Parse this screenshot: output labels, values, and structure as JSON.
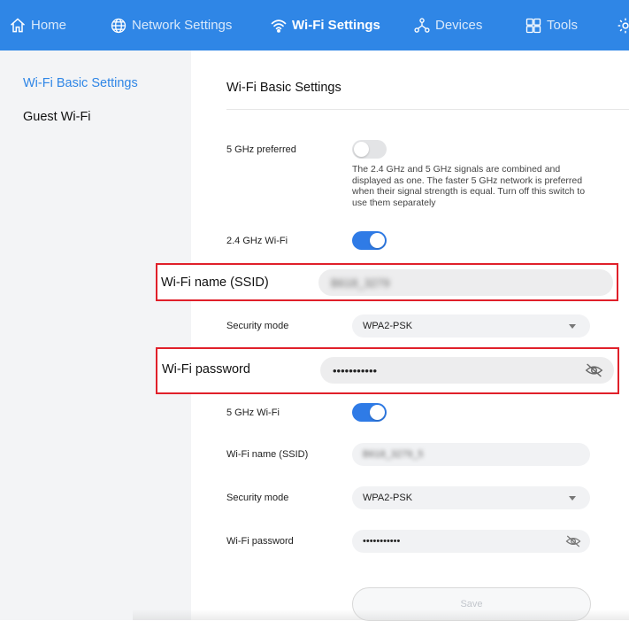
{
  "nav": {
    "home": "Home",
    "network": "Network Settings",
    "wifi": "Wi-Fi Settings",
    "devices": "Devices",
    "tools": "Tools"
  },
  "sidebar": {
    "items": [
      {
        "label": "Wi-Fi Basic Settings"
      },
      {
        "label": "Guest Wi-Fi"
      }
    ]
  },
  "main": {
    "title": "Wi-Fi Basic Settings",
    "pref5": {
      "label": "5 GHz preferred",
      "on": false,
      "description": "The 2.4 GHz and 5 GHz signals are combined and displayed as one. The faster 5 GHz network is preferred when their signal strength is equal. Turn off this switch to use them separately"
    },
    "band24": {
      "label": "2.4 GHz Wi-Fi",
      "on": true,
      "ssid_label": "Wi-Fi name (SSID)",
      "ssid_value": "B618_3279",
      "security_label": "Security mode",
      "security_value": "WPA2-PSK",
      "password_label": "Wi-Fi password",
      "password_value": "•••••••••••"
    },
    "band5": {
      "label": "5 GHz Wi-Fi",
      "on": true,
      "ssid_label": "Wi-Fi name (SSID)",
      "ssid_value": "B618_3279_5",
      "security_label": "Security mode",
      "security_value": "WPA2-PSK",
      "password_label": "Wi-Fi password",
      "password_value": "•••••••••••"
    },
    "save_label": "Save"
  },
  "colors": {
    "nav_bg": "#2f86e6",
    "accent": "#2f7be6",
    "highlight": "#e0202a"
  }
}
